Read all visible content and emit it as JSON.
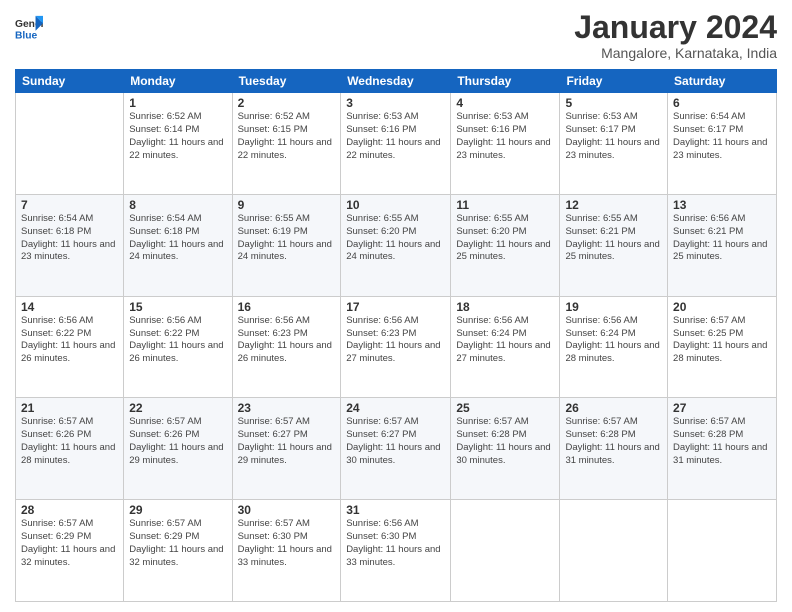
{
  "header": {
    "logo_general": "General",
    "logo_blue": "Blue",
    "month_title": "January 2024",
    "subtitle": "Mangalore, Karnataka, India"
  },
  "weekdays": [
    "Sunday",
    "Monday",
    "Tuesday",
    "Wednesday",
    "Thursday",
    "Friday",
    "Saturday"
  ],
  "weeks": [
    [
      {
        "day": "",
        "sunrise": "",
        "sunset": "",
        "daylight": ""
      },
      {
        "day": "1",
        "sunrise": "Sunrise: 6:52 AM",
        "sunset": "Sunset: 6:14 PM",
        "daylight": "Daylight: 11 hours and 22 minutes."
      },
      {
        "day": "2",
        "sunrise": "Sunrise: 6:52 AM",
        "sunset": "Sunset: 6:15 PM",
        "daylight": "Daylight: 11 hours and 22 minutes."
      },
      {
        "day": "3",
        "sunrise": "Sunrise: 6:53 AM",
        "sunset": "Sunset: 6:16 PM",
        "daylight": "Daylight: 11 hours and 22 minutes."
      },
      {
        "day": "4",
        "sunrise": "Sunrise: 6:53 AM",
        "sunset": "Sunset: 6:16 PM",
        "daylight": "Daylight: 11 hours and 23 minutes."
      },
      {
        "day": "5",
        "sunrise": "Sunrise: 6:53 AM",
        "sunset": "Sunset: 6:17 PM",
        "daylight": "Daylight: 11 hours and 23 minutes."
      },
      {
        "day": "6",
        "sunrise": "Sunrise: 6:54 AM",
        "sunset": "Sunset: 6:17 PM",
        "daylight": "Daylight: 11 hours and 23 minutes."
      }
    ],
    [
      {
        "day": "7",
        "sunrise": "Sunrise: 6:54 AM",
        "sunset": "Sunset: 6:18 PM",
        "daylight": "Daylight: 11 hours and 23 minutes."
      },
      {
        "day": "8",
        "sunrise": "Sunrise: 6:54 AM",
        "sunset": "Sunset: 6:18 PM",
        "daylight": "Daylight: 11 hours and 24 minutes."
      },
      {
        "day": "9",
        "sunrise": "Sunrise: 6:55 AM",
        "sunset": "Sunset: 6:19 PM",
        "daylight": "Daylight: 11 hours and 24 minutes."
      },
      {
        "day": "10",
        "sunrise": "Sunrise: 6:55 AM",
        "sunset": "Sunset: 6:20 PM",
        "daylight": "Daylight: 11 hours and 24 minutes."
      },
      {
        "day": "11",
        "sunrise": "Sunrise: 6:55 AM",
        "sunset": "Sunset: 6:20 PM",
        "daylight": "Daylight: 11 hours and 25 minutes."
      },
      {
        "day": "12",
        "sunrise": "Sunrise: 6:55 AM",
        "sunset": "Sunset: 6:21 PM",
        "daylight": "Daylight: 11 hours and 25 minutes."
      },
      {
        "day": "13",
        "sunrise": "Sunrise: 6:56 AM",
        "sunset": "Sunset: 6:21 PM",
        "daylight": "Daylight: 11 hours and 25 minutes."
      }
    ],
    [
      {
        "day": "14",
        "sunrise": "Sunrise: 6:56 AM",
        "sunset": "Sunset: 6:22 PM",
        "daylight": "Daylight: 11 hours and 26 minutes."
      },
      {
        "day": "15",
        "sunrise": "Sunrise: 6:56 AM",
        "sunset": "Sunset: 6:22 PM",
        "daylight": "Daylight: 11 hours and 26 minutes."
      },
      {
        "day": "16",
        "sunrise": "Sunrise: 6:56 AM",
        "sunset": "Sunset: 6:23 PM",
        "daylight": "Daylight: 11 hours and 26 minutes."
      },
      {
        "day": "17",
        "sunrise": "Sunrise: 6:56 AM",
        "sunset": "Sunset: 6:23 PM",
        "daylight": "Daylight: 11 hours and 27 minutes."
      },
      {
        "day": "18",
        "sunrise": "Sunrise: 6:56 AM",
        "sunset": "Sunset: 6:24 PM",
        "daylight": "Daylight: 11 hours and 27 minutes."
      },
      {
        "day": "19",
        "sunrise": "Sunrise: 6:56 AM",
        "sunset": "Sunset: 6:24 PM",
        "daylight": "Daylight: 11 hours and 28 minutes."
      },
      {
        "day": "20",
        "sunrise": "Sunrise: 6:57 AM",
        "sunset": "Sunset: 6:25 PM",
        "daylight": "Daylight: 11 hours and 28 minutes."
      }
    ],
    [
      {
        "day": "21",
        "sunrise": "Sunrise: 6:57 AM",
        "sunset": "Sunset: 6:26 PM",
        "daylight": "Daylight: 11 hours and 28 minutes."
      },
      {
        "day": "22",
        "sunrise": "Sunrise: 6:57 AM",
        "sunset": "Sunset: 6:26 PM",
        "daylight": "Daylight: 11 hours and 29 minutes."
      },
      {
        "day": "23",
        "sunrise": "Sunrise: 6:57 AM",
        "sunset": "Sunset: 6:27 PM",
        "daylight": "Daylight: 11 hours and 29 minutes."
      },
      {
        "day": "24",
        "sunrise": "Sunrise: 6:57 AM",
        "sunset": "Sunset: 6:27 PM",
        "daylight": "Daylight: 11 hours and 30 minutes."
      },
      {
        "day": "25",
        "sunrise": "Sunrise: 6:57 AM",
        "sunset": "Sunset: 6:28 PM",
        "daylight": "Daylight: 11 hours and 30 minutes."
      },
      {
        "day": "26",
        "sunrise": "Sunrise: 6:57 AM",
        "sunset": "Sunset: 6:28 PM",
        "daylight": "Daylight: 11 hours and 31 minutes."
      },
      {
        "day": "27",
        "sunrise": "Sunrise: 6:57 AM",
        "sunset": "Sunset: 6:28 PM",
        "daylight": "Daylight: 11 hours and 31 minutes."
      }
    ],
    [
      {
        "day": "28",
        "sunrise": "Sunrise: 6:57 AM",
        "sunset": "Sunset: 6:29 PM",
        "daylight": "Daylight: 11 hours and 32 minutes."
      },
      {
        "day": "29",
        "sunrise": "Sunrise: 6:57 AM",
        "sunset": "Sunset: 6:29 PM",
        "daylight": "Daylight: 11 hours and 32 minutes."
      },
      {
        "day": "30",
        "sunrise": "Sunrise: 6:57 AM",
        "sunset": "Sunset: 6:30 PM",
        "daylight": "Daylight: 11 hours and 33 minutes."
      },
      {
        "day": "31",
        "sunrise": "Sunrise: 6:56 AM",
        "sunset": "Sunset: 6:30 PM",
        "daylight": "Daylight: 11 hours and 33 minutes."
      },
      {
        "day": "",
        "sunrise": "",
        "sunset": "",
        "daylight": ""
      },
      {
        "day": "",
        "sunrise": "",
        "sunset": "",
        "daylight": ""
      },
      {
        "day": "",
        "sunrise": "",
        "sunset": "",
        "daylight": ""
      }
    ]
  ]
}
